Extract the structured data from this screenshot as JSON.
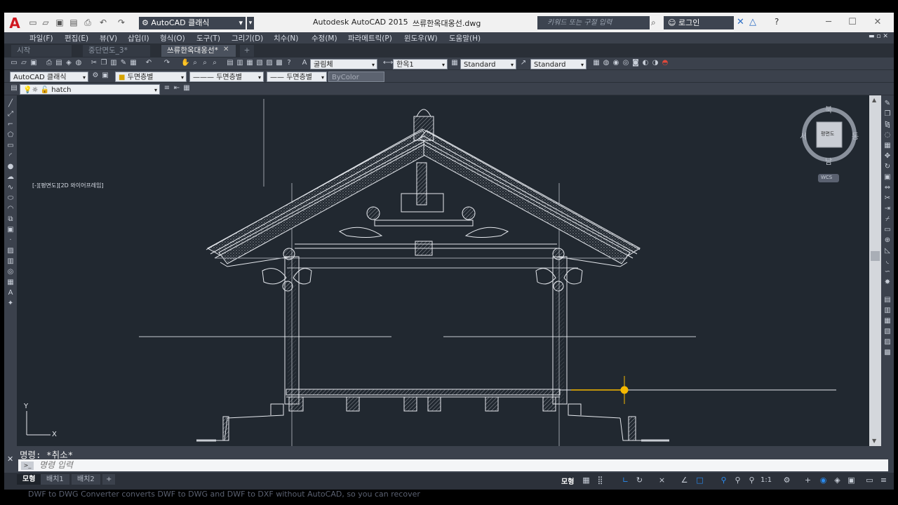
{
  "title_bar": {
    "workspace": "AutoCAD 클래식",
    "app_title": "Autodesk AutoCAD 2015",
    "file_title": "쓰류한옥대옹선.dwg",
    "search_placeholder": "키워드 또는 구절 입력",
    "login": "로그인"
  },
  "menu": [
    "파일(F)",
    "편집(E)",
    "뷰(V)",
    "삽입(I)",
    "형식(O)",
    "도구(T)",
    "그리기(D)",
    "치수(N)",
    "수정(M)",
    "파라메트릭(P)",
    "윈도우(W)",
    "도움말(H)"
  ],
  "doc_tabs": [
    {
      "label": "시작",
      "active": false
    },
    {
      "label": "중단면도_3*",
      "active": false
    },
    {
      "label": "쓰류한옥대옹선*",
      "active": true
    }
  ],
  "toolbar": {
    "text_style": "굴림체",
    "dim_style": "한옥1",
    "table_style": "Standard",
    "ml_style": "Standard",
    "workspace2": "AutoCAD 클래식",
    "layer_color": "두면층별",
    "linetype": "두면층별",
    "lineweight": "두면층별",
    "plot_style": "ByColor",
    "layer": "hatch"
  },
  "viewport": {
    "label": "[-][평면도][2D 와이어프레임]",
    "viewcube_face": "평면도",
    "compass": {
      "n": "북",
      "s": "남",
      "e": "동",
      "w": "서"
    },
    "wcs": "WCS",
    "ucs_x": "X",
    "ucs_y": "Y"
  },
  "command": {
    "output": "명령: *취소*",
    "input_placeholder": "명령 입력"
  },
  "layout_tabs": [
    {
      "label": "모형",
      "active": true
    },
    {
      "label": "배치1",
      "active": false
    },
    {
      "label": "배치2",
      "active": false
    }
  ],
  "status": {
    "model": "모형",
    "scale": "1:1"
  },
  "overlay_text": "DWF to DWG Converter converts DWF to DWG and DWF to DXF without AutoCAD, so you can recover",
  "colors": {
    "accent_red": "#d01820",
    "canvas": "#212830",
    "grip": "#f5b800"
  }
}
